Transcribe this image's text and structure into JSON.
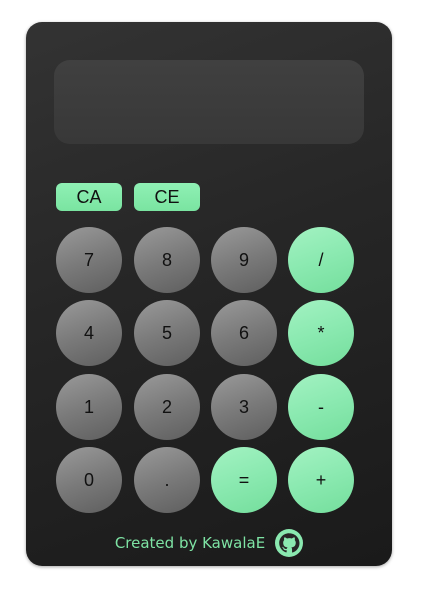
{
  "display": {
    "value": ""
  },
  "clear_buttons": [
    {
      "label": "CA"
    },
    {
      "label": "CE"
    }
  ],
  "keys": [
    {
      "label": "7",
      "kind": "num"
    },
    {
      "label": "8",
      "kind": "num"
    },
    {
      "label": "9",
      "kind": "num"
    },
    {
      "label": "/",
      "kind": "op"
    },
    {
      "label": "4",
      "kind": "num"
    },
    {
      "label": "5",
      "kind": "num"
    },
    {
      "label": "6",
      "kind": "num"
    },
    {
      "label": "*",
      "kind": "op"
    },
    {
      "label": "1",
      "kind": "num"
    },
    {
      "label": "2",
      "kind": "num"
    },
    {
      "label": "3",
      "kind": "num"
    },
    {
      "label": "-",
      "kind": "op"
    },
    {
      "label": "0",
      "kind": "num"
    },
    {
      "label": ".",
      "kind": "num"
    },
    {
      "label": "=",
      "kind": "op"
    },
    {
      "label": "+",
      "kind": "op"
    }
  ],
  "footer": {
    "text": "Created by KawalaE",
    "icon": "github-icon"
  },
  "colors": {
    "accent": "#8ae9b0",
    "number_key": "#7a7a7a",
    "body": "#262626",
    "display": "#3c3c3c",
    "footer_text": "#7ee3a4"
  }
}
